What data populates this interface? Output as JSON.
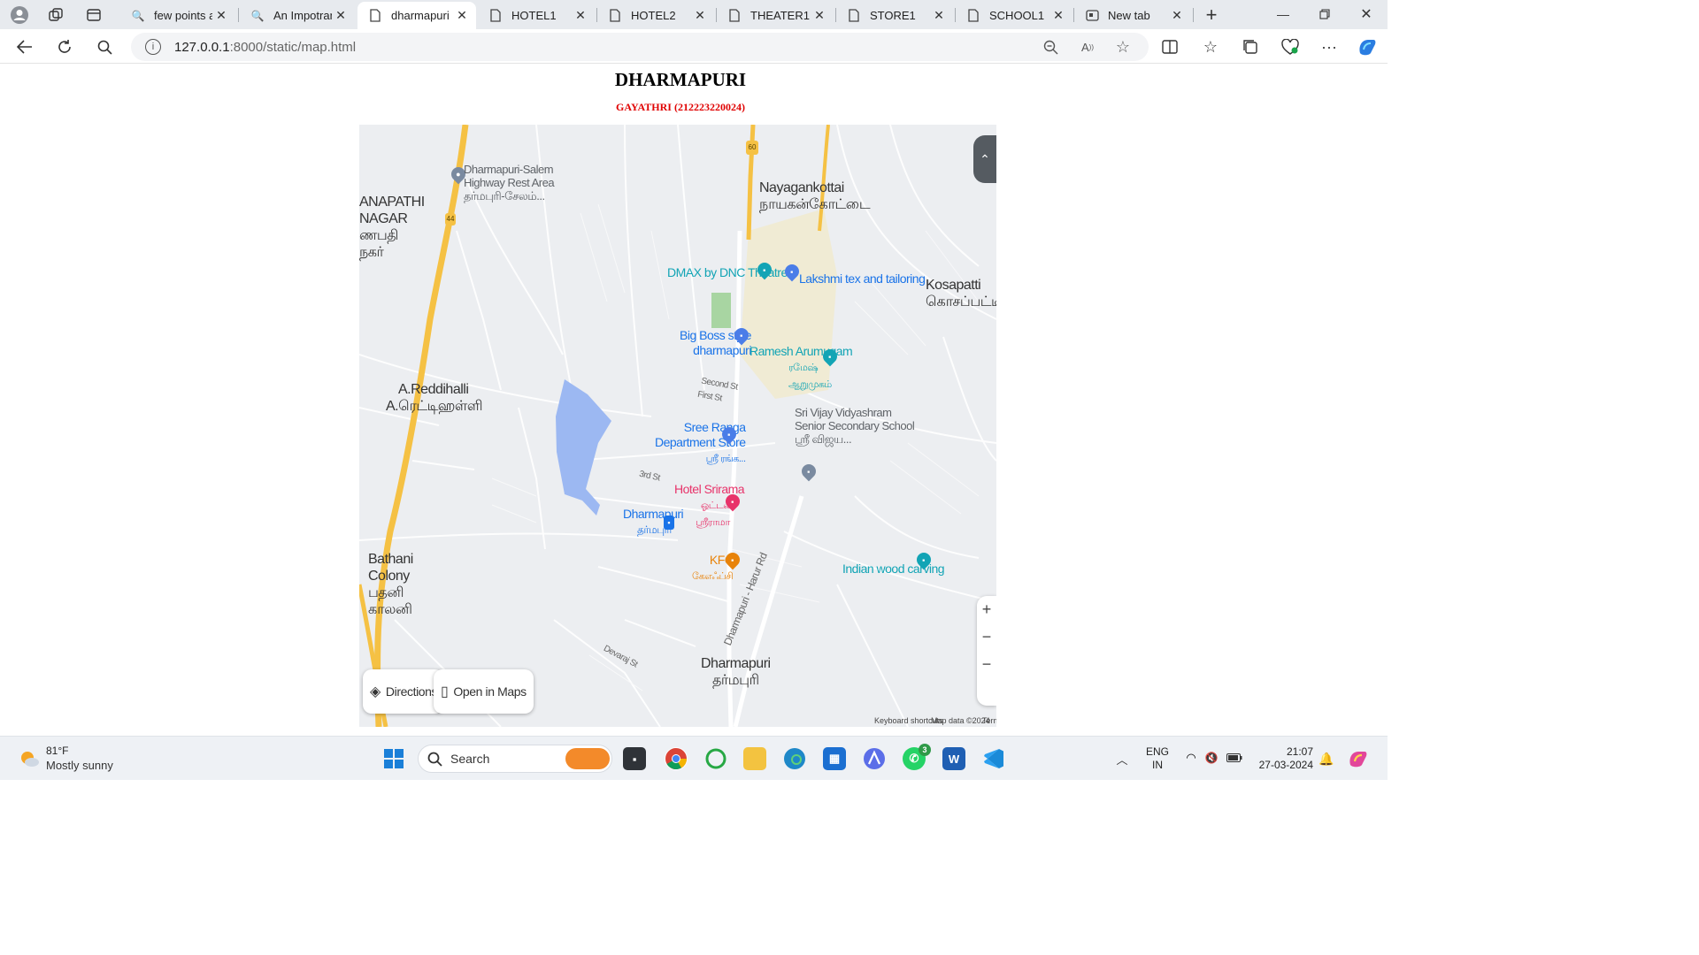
{
  "browser": {
    "tabs": [
      {
        "label": "few points ab",
        "icon": "search-icon",
        "active": false
      },
      {
        "label": "An Impotran",
        "icon": "search-icon",
        "active": false
      },
      {
        "label": "dharmapuri",
        "icon": "page-icon",
        "active": true
      },
      {
        "label": "HOTEL1",
        "icon": "page-icon",
        "active": false
      },
      {
        "label": "HOTEL2",
        "icon": "page-icon",
        "active": false
      },
      {
        "label": "THEATER1",
        "icon": "page-icon",
        "active": false
      },
      {
        "label": "STORE1",
        "icon": "page-icon",
        "active": false
      },
      {
        "label": "SCHOOL1",
        "icon": "page-icon",
        "active": false
      },
      {
        "label": "New tab",
        "icon": "newtab-icon",
        "active": false
      }
    ],
    "url_host": "127.0.0.1",
    "url_rest": ":8000/static/map.html"
  },
  "page": {
    "title": "DHARMAPURI",
    "subtitle": "GAYATHRI (212223220024)",
    "subtitle_color": "#e00000"
  },
  "map": {
    "labels": {
      "ganapathi_1": "ANAPATHI",
      "ganapathi_2": "NAGAR",
      "ganapathi_3": "ணபதி",
      "ganapathi_4": "நகர்",
      "restarea_1": "Dharmapuri-Salem",
      "restarea_2": "Highway Rest Area",
      "restarea_3": "தர்மபுரி-சேலம்...",
      "nayagankottai_1": "Nayagankottai",
      "nayagankottai_2": "நாயகன்கோட்டை",
      "dmax": "DMAX by DNC Theatres",
      "lakshmi": "Lakshmi tex and tailoring",
      "kosapatti_1": "Kosapatti",
      "kosapatti_2": "கொசப்பட்டி",
      "bigboss_1": "Big Boss style",
      "bigboss_2": "dharmapuri",
      "ramesh_1": "Ramesh Arumugam",
      "ramesh_2": "ரமேஷ்",
      "ramesh_3": "ஆறுமுகம்",
      "reddihalli_1": "A.Reddihalli",
      "reddihalli_2": "A.ரெட்டிஹள்ளி",
      "second_st": "Second St",
      "first_st": "First St",
      "vijay_1": "Sri Vijay Vidyashram",
      "vijay_2": "Senior Secondary School",
      "vijay_3": "ஸ்ரீ விஜய...",
      "sreeranga_1": "Sree Ranga",
      "sreeranga_2": "Department Store",
      "sreeranga_3": "ஸ்ரீ ரங்க...",
      "third_st": "3rd St",
      "srirama_1": "Hotel Srirama",
      "srirama_2": "ஓட்டல்",
      "srirama_3": "ஸ்ரீராமா",
      "dharmapuri_bus_1": "Dharmapuri",
      "dharmapuri_bus_2": "தர்மபுரி",
      "kfc_1": "KFC",
      "kfc_2": "கேஎஃப்சி",
      "indian_wood": "Indian wood carving",
      "bathani_1": "Bathani",
      "bathani_2": "Colony",
      "bathani_3": "பதனி",
      "bathani_4": "காலனி",
      "harur_rd": "Dharmapuri - Harur Rd",
      "devaraj_st": "Devaraj St",
      "dharmapuri_1": "Dharmapuri",
      "dharmapuri_2": "தர்மபுரி",
      "nh44": "44",
      "nh60": "60"
    },
    "directions_label": "Directions",
    "open_maps_label": "Open in Maps",
    "zoom_in": "+",
    "zoom_out": "−",
    "attribution": [
      "Keyboard shortcuts",
      "Map data ©2024",
      "Terms"
    ],
    "colors": {
      "water": "#9cb8f2",
      "highway": "#f5c144",
      "park": "#a8d5a2",
      "town": "#f3ecd2"
    }
  },
  "taskbar": {
    "weather_temp": "81°F",
    "weather_desc": "Mostly sunny",
    "search_placeholder": "Search",
    "whatsapp_badge": "3",
    "lang_1": "ENG",
    "lang_2": "IN",
    "time": "21:07",
    "date": "27-03-2024"
  }
}
